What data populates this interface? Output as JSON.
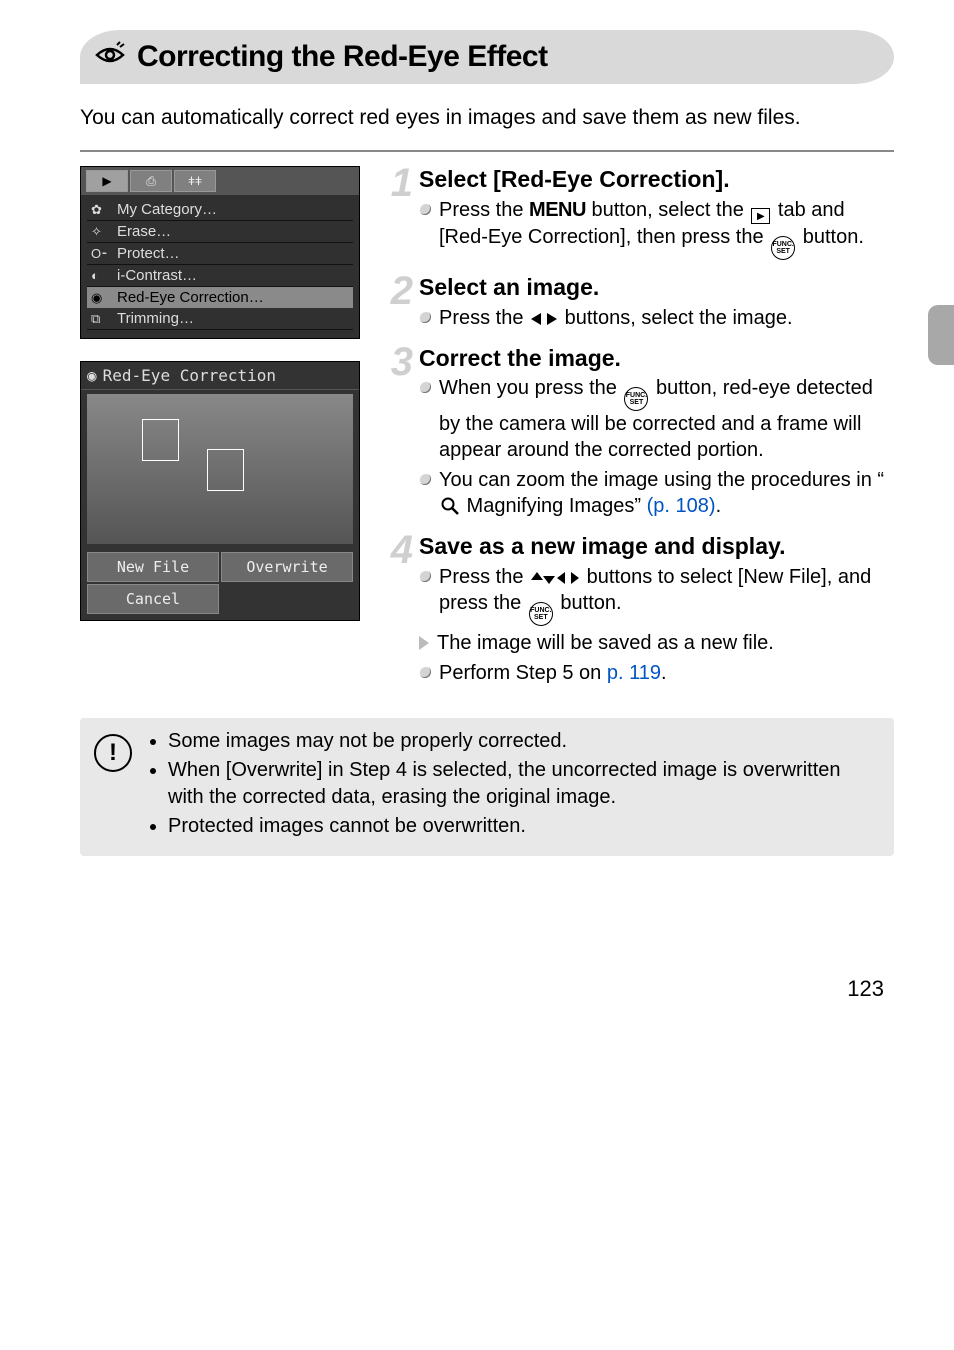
{
  "title": "Correcting the Red-Eye Effect",
  "intro": "You can automatically correct red eyes in images and save them as new files.",
  "page_number": "123",
  "menu": {
    "items": [
      {
        "label": "My Category…"
      },
      {
        "label": "Erase…"
      },
      {
        "label": "Protect…"
      },
      {
        "label": "i-Contrast…"
      },
      {
        "label": "Red-Eye Correction…"
      },
      {
        "label": "Trimming…"
      }
    ]
  },
  "redeye": {
    "title": "Red-Eye Correction",
    "new_file": "New File",
    "overwrite": "Overwrite",
    "cancel": "Cancel"
  },
  "steps": {
    "s1": {
      "title": "Select [Red-Eye Correction].",
      "b1a": "Press the ",
      "b1_menu": "MENU",
      "b1b": " button, select the ",
      "b1c": " tab and [Red-Eye Correction], then press the ",
      "b1d": " button."
    },
    "s2": {
      "title": "Select an image.",
      "b1a": "Press the ",
      "b1b": " buttons, select the image."
    },
    "s3": {
      "title": "Correct the image.",
      "b1a": "When you press the ",
      "b1b": " button, red-eye detected by the camera will be corrected and a frame will appear around the corrected portion.",
      "b2a": "You can zoom the image using the procedures in “",
      "b2b": " Magnifying Images” ",
      "b2_link": "(p. 108)",
      "b2c": "."
    },
    "s4": {
      "title": "Save as a new image and display.",
      "b1a": "Press the ",
      "b1b": " buttons to select [New File], and press the ",
      "b1c": " button.",
      "b2": "The image will be saved as a new file.",
      "b3a": "Perform Step 5 on ",
      "b3_link": "p. 119",
      "b3b": "."
    }
  },
  "caution": {
    "c1": "Some images may not be properly corrected.",
    "c2": "When [Overwrite] in Step 4 is selected, the uncorrected image is overwritten with the corrected data, erasing the original image.",
    "c3": "Protected images cannot be overwritten."
  }
}
